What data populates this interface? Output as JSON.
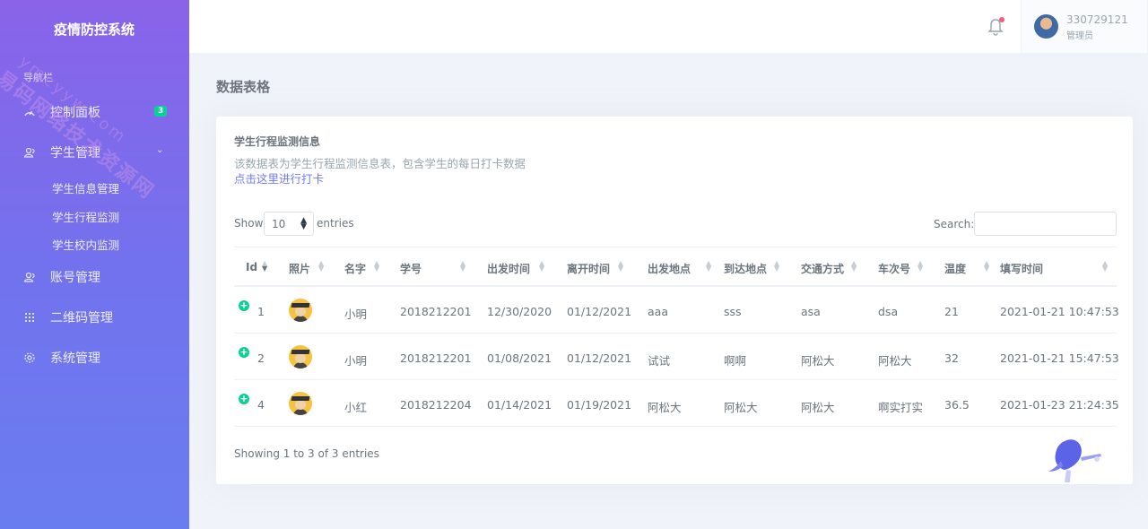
{
  "app": {
    "title": "疫情防控系统"
  },
  "watermark": {
    "line1": "易码网络技术资源网",
    "line2": "ymcyyw.com"
  },
  "sidebar": {
    "caption": "导航栏",
    "items": [
      {
        "label": "控制面板",
        "icon": "dashboard-icon",
        "badge": "3"
      },
      {
        "label": "学生管理",
        "icon": "users-icon",
        "chevron": "⌄"
      },
      {
        "label": "账号管理",
        "icon": "account-icon"
      },
      {
        "label": "二维码管理",
        "icon": "qrcode-icon"
      },
      {
        "label": "系统管理",
        "icon": "gear-icon"
      }
    ],
    "sub_items": [
      "学生信息管理",
      "学生行程监测",
      "学生校内监测"
    ]
  },
  "topbar": {
    "user": {
      "name": "330729121",
      "role": "管理员"
    },
    "icons": [
      "bell-icon"
    ]
  },
  "page": {
    "title": "数据表格"
  },
  "card": {
    "title": "学生行程监测信息",
    "description": "该数据表为学生行程监测信息表，包含学生的每日打卡数据",
    "link": "点击这里进行打卡"
  },
  "table_controls": {
    "show": "Show",
    "length": "10",
    "entries": "entries",
    "search_label": "Search:",
    "search_value": ""
  },
  "table": {
    "columns": [
      "Id",
      "照片",
      "名字",
      "学号",
      "出发时间",
      "离开时间",
      "出发地点",
      "到达地点",
      "交通方式",
      "车次号",
      "温度",
      "填写时间"
    ],
    "rows": [
      {
        "id": "1",
        "name": "小明",
        "student_no": "2018212201",
        "depart": "12/30/2020",
        "leave": "01/12/2021",
        "from": "aaa",
        "to": "sss",
        "transport": "asa",
        "train": "dsa",
        "temp": "21",
        "filled": "2021-01-21 10:47:53"
      },
      {
        "id": "2",
        "name": "小明",
        "student_no": "2018212201",
        "depart": "01/08/2021",
        "leave": "01/12/2021",
        "from": "试试",
        "to": "啊啊",
        "transport": "阿松大",
        "train": "阿松大",
        "temp": "32",
        "filled": "2021-01-21 15:47:53"
      },
      {
        "id": "4",
        "name": "小红",
        "student_no": "2018212204",
        "depart": "01/14/2021",
        "leave": "01/19/2021",
        "from": "阿松大",
        "to": "阿松大",
        "transport": "阿松大",
        "train": "啊实打实",
        "temp": "36.5",
        "filled": "2021-01-23 21:24:35"
      }
    ],
    "info": "Showing 1 to 3 of 3 entries"
  },
  "colors": {
    "sidebar_top": "#8a63e9",
    "sidebar_bottom": "#6a7df0",
    "accent": "#727cf5",
    "badge": "#0acf97",
    "bell_dot": "#fa5c7c"
  }
}
